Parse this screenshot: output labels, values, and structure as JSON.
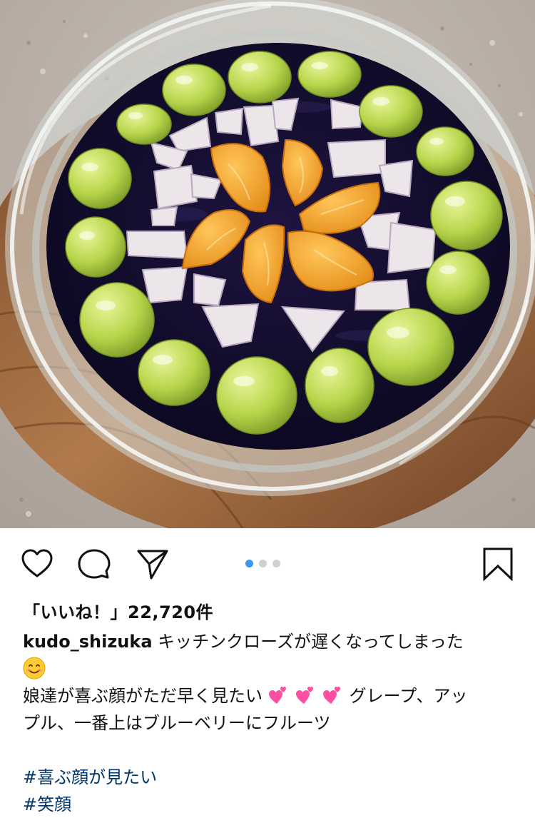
{
  "post": {
    "image": {
      "subject": "glass-bowl-fruit-jelly"
    },
    "carousel": {
      "count": 3,
      "active_index": 0,
      "active_color": "#3897f0"
    },
    "actions": {
      "like_icon": "heart-outline-icon",
      "comment_icon": "comment-icon",
      "share_icon": "paper-plane-icon",
      "save_icon": "bookmark-icon"
    },
    "likes": "「いいね！」22,720件",
    "caption": {
      "username": "kudo_shizuka",
      "line1": "キッチンクローズが遅くなってしまった",
      "line2_text": "娘達が喜ぶ顔がただ早く見たい",
      "line2_after": "グレープ、アッ",
      "line3": "プル、一番上はブルーベリーにフルーツ",
      "emoji_smile": "smiling-face-emoji",
      "emoji_hearts": "two-hearts-emoji"
    },
    "hashtags": [
      "#喜ぶ顔が見たい",
      "#笑顔"
    ],
    "hashtag_color": "#00376b"
  }
}
